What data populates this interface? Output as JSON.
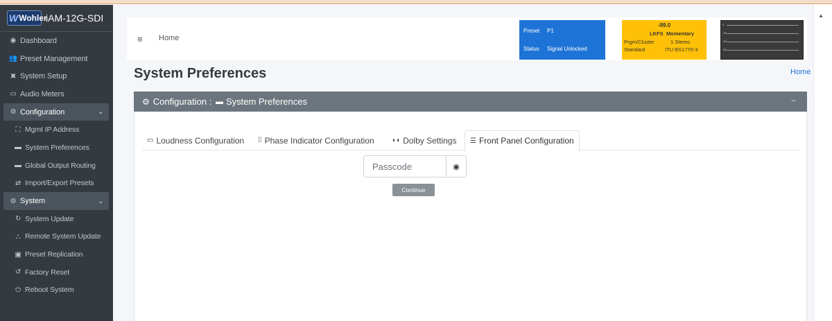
{
  "brand": {
    "logo_text": "Wohler",
    "product": "iAM-12G-SDI"
  },
  "sidebar": {
    "items": [
      {
        "label": "Dashboard",
        "icon": "dashboard-icon",
        "glyph": "◉"
      },
      {
        "label": "Preset Management",
        "icon": "users-icon",
        "glyph": "👥"
      },
      {
        "label": "System Setup",
        "icon": "tools-icon",
        "glyph": "✖"
      },
      {
        "label": "Audio Meters",
        "icon": "chart-icon",
        "glyph": "▭"
      }
    ],
    "config_header": {
      "label": "Configuration",
      "glyph": "⚙",
      "chevron": "⌄"
    },
    "config_items": [
      {
        "label": "Mgmt IP Address",
        "icon": "network-icon",
        "glyph": "⛶"
      },
      {
        "label": "System Preferences",
        "icon": "keyboard-icon",
        "glyph": "▬"
      },
      {
        "label": "Global Output Routing",
        "icon": "routing-icon",
        "glyph": "▬"
      },
      {
        "label": "Import/Export Presets",
        "icon": "exchange-icon",
        "glyph": "⇄"
      }
    ],
    "system_header": {
      "label": "System",
      "glyph": "⚙",
      "chevron": "⌄"
    },
    "system_items": [
      {
        "label": "System Update",
        "icon": "sync-icon",
        "glyph": "↻"
      },
      {
        "label": "Remote System Update",
        "icon": "network-wired-icon",
        "glyph": "⛬"
      },
      {
        "label": "Preset Replication",
        "icon": "clone-icon",
        "glyph": "▣"
      },
      {
        "label": "Factory Reset",
        "icon": "undo-icon",
        "glyph": "↺"
      },
      {
        "label": "Reboot System",
        "icon": "power-icon",
        "glyph": "⏻"
      }
    ]
  },
  "topbar": {
    "menu_glyph": "≡",
    "home_label": "Home",
    "preset_label": "Preset",
    "preset_value": "P1",
    "status_label": "Status",
    "status_value": "Signal Unlocked",
    "lkfs_value": "-99.0",
    "lkfs_label": "LKFS",
    "lkfs_mode": "Momentary",
    "cluster_label": "Prgm/Cluster",
    "cluster_value": "1  Stereo",
    "standard_label": "Standard",
    "standard_value": "ITU BS1770-3",
    "meter_ticks": [
      "0",
      "-20",
      "-40",
      "-60"
    ]
  },
  "page": {
    "title": "System Preferences",
    "breadcrumb": "Home"
  },
  "card": {
    "header_prefix": "Configuration : ",
    "header_title": "System Preferences",
    "collapse_glyph": "−"
  },
  "tabs": [
    {
      "label": "Loudness Configuration",
      "glyph": "▭"
    },
    {
      "label": "Phase Indicator Configuration",
      "glyph": "⁞⁞"
    },
    {
      "label": "Dolby Settings",
      "glyph": "◗◖"
    },
    {
      "label": "Front Panel Configuration",
      "glyph": "☰"
    }
  ],
  "form": {
    "passcode_placeholder": "Passcode",
    "eye_glyph": "👁",
    "continue_label": "Continue"
  },
  "colors": {
    "sidebar_bg": "#343a40",
    "preset_blue": "#1e73d6",
    "lkfs_yellow": "#ffc107",
    "card_header": "#6c757d"
  }
}
